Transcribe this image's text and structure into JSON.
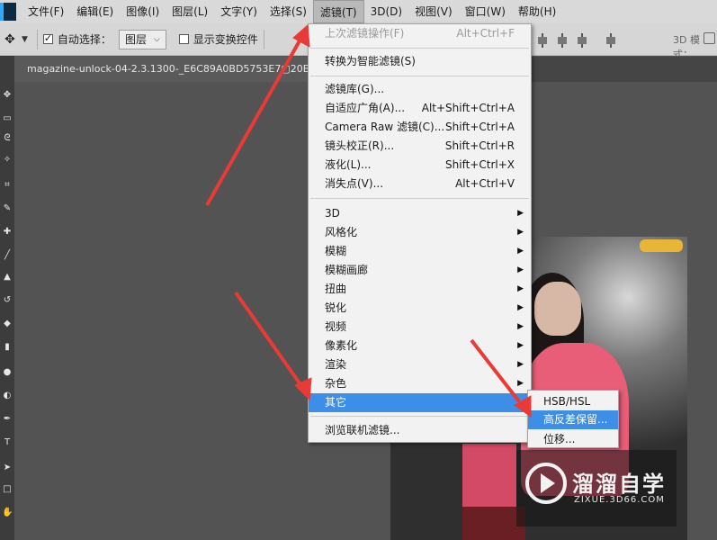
{
  "menubar": {
    "items": [
      "文件(F)",
      "编辑(E)",
      "图像(I)",
      "图层(L)",
      "文字(Y)",
      "选择(S)",
      "滤镜(T)",
      "3D(D)",
      "视图(V)",
      "窗口(W)",
      "帮助(H)"
    ]
  },
  "options_bar": {
    "auto_select_label": "自动选择：",
    "auto_select_target": "图层",
    "show_transform_label": "显示变换控件",
    "mode_3d_label": "3D 模式："
  },
  "document": {
    "tab_title": "magazine-unlock-04-2.3.1300-_E6C89A0BD5753E7▢20B0"
  },
  "filter_menu": {
    "last_filter": {
      "label": "上次滤镜操作(F)",
      "shortcut": "Alt+Ctrl+F"
    },
    "convert_smart": {
      "label": "转换为智能滤镜(S)"
    },
    "gallery": {
      "label": "滤镜库(G)..."
    },
    "adaptive_wide": {
      "label": "自适应广角(A)...",
      "shortcut": "Alt+Shift+Ctrl+A"
    },
    "camera_raw": {
      "label": "Camera Raw 滤镜(C)...",
      "shortcut": "Shift+Ctrl+A"
    },
    "lens_correction": {
      "label": "镜头校正(R)...",
      "shortcut": "Shift+Ctrl+R"
    },
    "liquify": {
      "label": "液化(L)...",
      "shortcut": "Shift+Ctrl+X"
    },
    "vanishing_point": {
      "label": "消失点(V)...",
      "shortcut": "Alt+Ctrl+V"
    },
    "submenus": [
      "3D",
      "风格化",
      "模糊",
      "模糊画廊",
      "扭曲",
      "锐化",
      "视频",
      "像素化",
      "渲染",
      "杂色",
      "其它"
    ],
    "browse_online": {
      "label": "浏览联机滤镜..."
    }
  },
  "other_submenu": {
    "items": [
      "HSB/HSL",
      "高反差保留...",
      "位移..."
    ]
  },
  "watermark": {
    "title": "溜溜自学",
    "url": "ZIXUE.3D66.COM"
  },
  "colors": {
    "highlight": "#3c8ee6",
    "annotation_arrow": "#e83a36"
  }
}
